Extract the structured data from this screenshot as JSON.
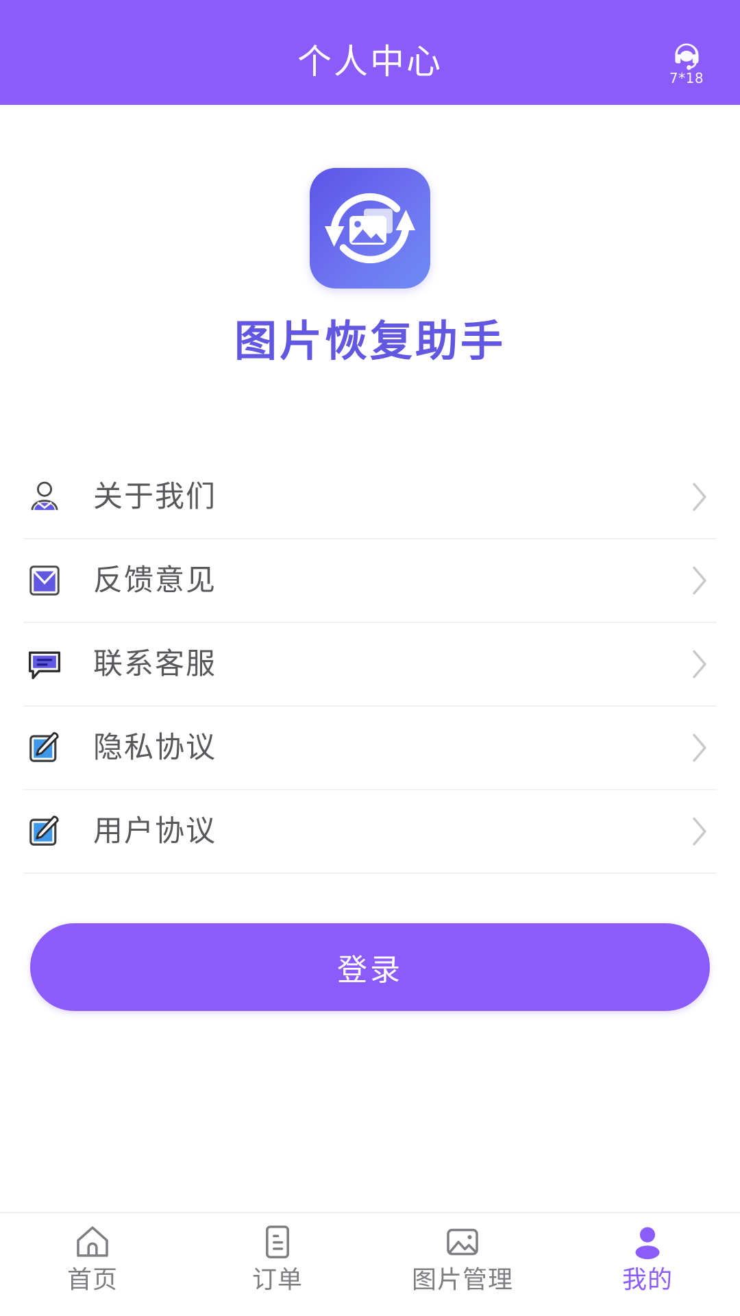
{
  "header": {
    "title": "个人中心",
    "service": {
      "icon": "headset-icon",
      "label": "7*18"
    },
    "background_color": "#8B5CFA"
  },
  "brand": {
    "logo_icon": "photo-recovery-logo",
    "app_name": "图片恢复助手",
    "app_name_color": "#6257E0"
  },
  "menu": {
    "items": [
      {
        "label": "关于我们",
        "icon": "about-user-icon",
        "chevron": "chevron-right-icon"
      },
      {
        "label": "反馈意见",
        "icon": "mail-envelope-icon",
        "chevron": "chevron-right-icon"
      },
      {
        "label": "联系客服",
        "icon": "chat-bubble-icon",
        "chevron": "chevron-right-icon"
      },
      {
        "label": "隐私协议",
        "icon": "edit-document-icon",
        "chevron": "chevron-right-icon"
      },
      {
        "label": "用户协议",
        "icon": "edit-document-icon",
        "chevron": "chevron-right-icon"
      }
    ]
  },
  "login": {
    "label": "登录",
    "color": "#8B5CFA"
  },
  "tabbar": {
    "active_color": "#8B5CFA",
    "inactive_color": "#7d7d82",
    "items": [
      {
        "label": "首页",
        "icon": "home-icon",
        "active": false
      },
      {
        "label": "订单",
        "icon": "order-document-icon",
        "active": false
      },
      {
        "label": "图片管理",
        "icon": "image-gallery-icon",
        "active": false
      },
      {
        "label": "我的",
        "icon": "profile-person-icon",
        "active": true
      }
    ]
  }
}
